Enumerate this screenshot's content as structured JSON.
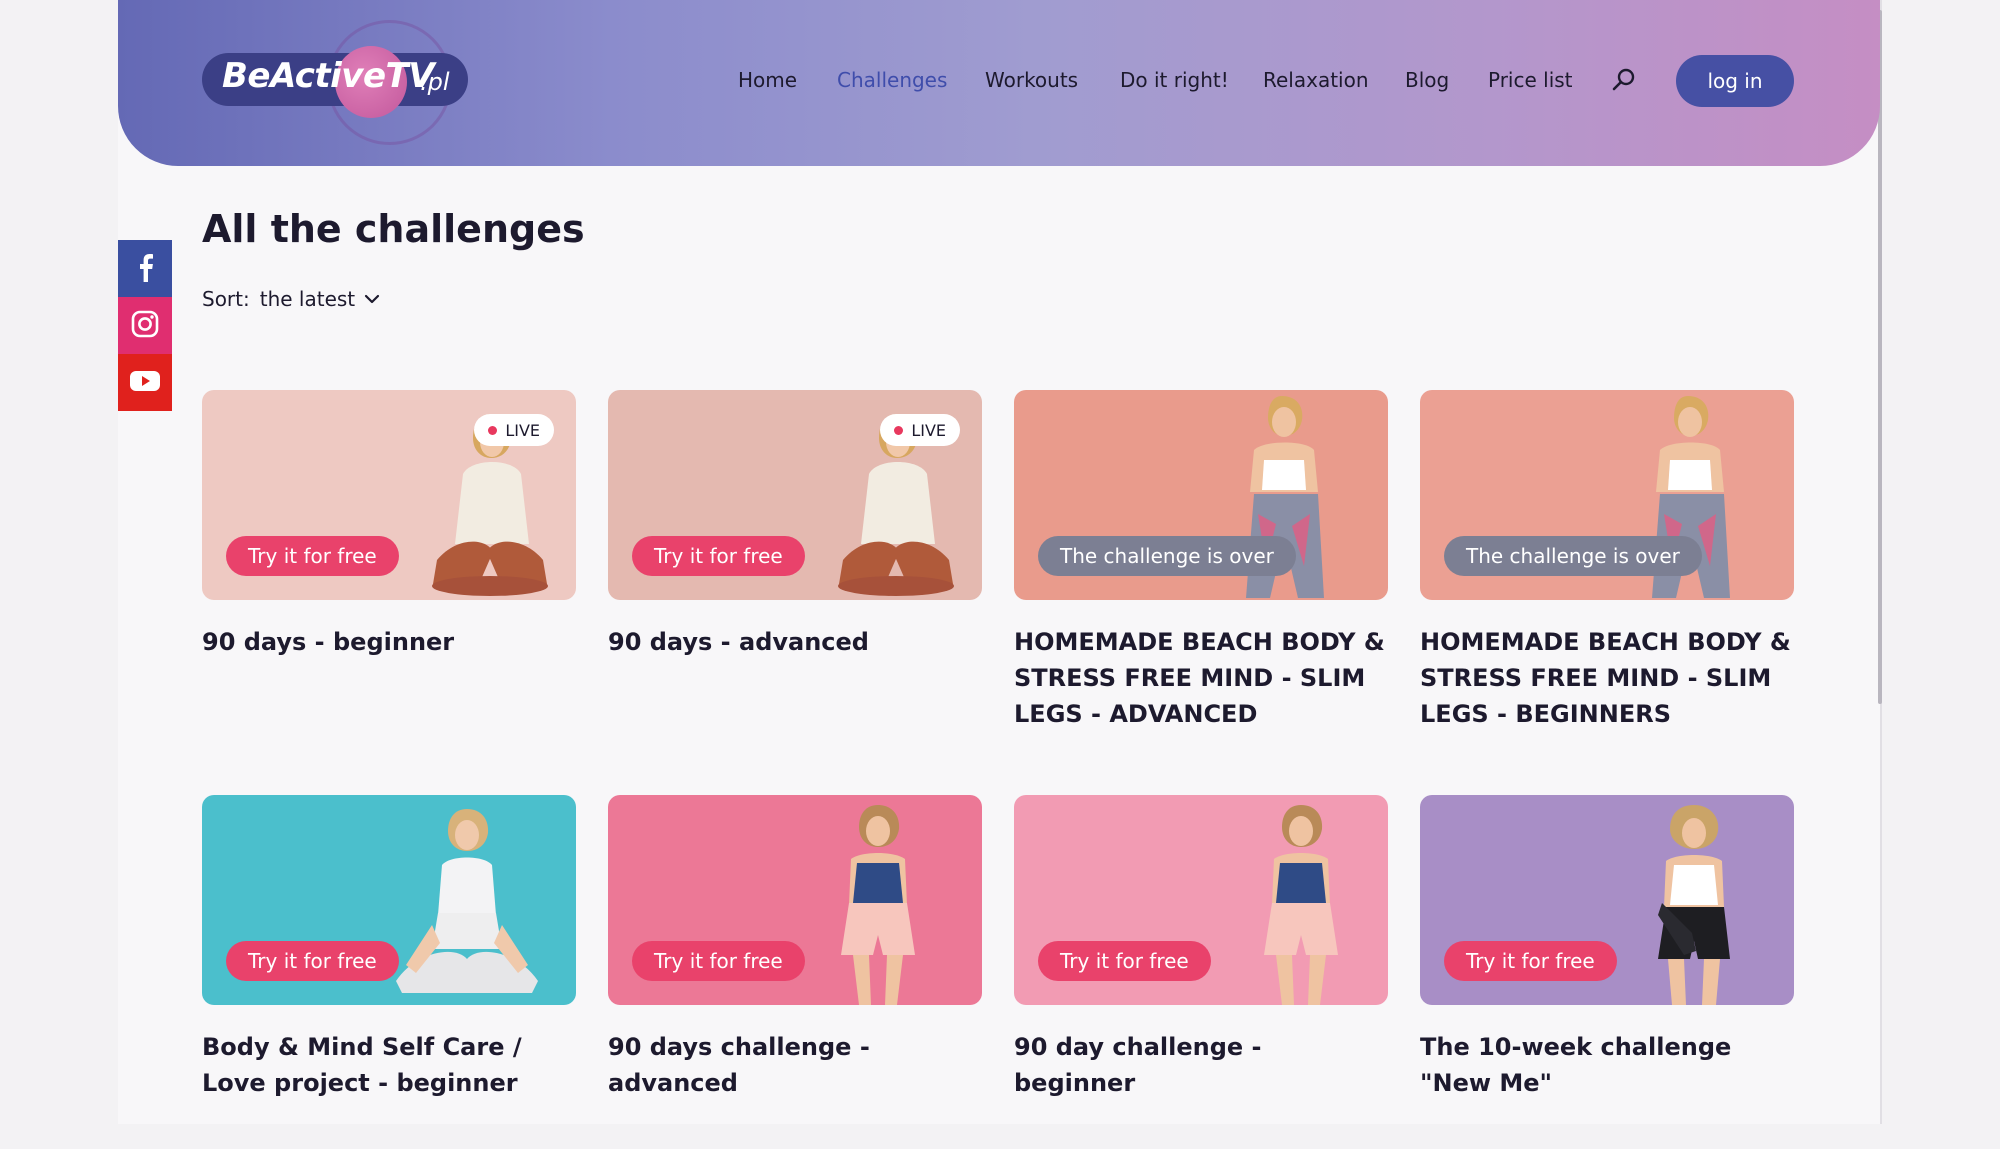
{
  "brand": {
    "logo_text": "BeActiveTV",
    "logo_suffix": ".pl"
  },
  "nav": {
    "items": [
      {
        "label": "Home"
      },
      {
        "label": "Challenges",
        "active": true
      },
      {
        "label": "Workouts"
      },
      {
        "label": "Do it right!"
      },
      {
        "label": "Relaxation"
      },
      {
        "label": "Blog"
      },
      {
        "label": "Price list"
      }
    ],
    "search_icon": "search-icon",
    "login_label": "log in"
  },
  "social": [
    {
      "name": "facebook-icon",
      "color": "#3a4fa0"
    },
    {
      "name": "instagram-icon",
      "color": "#e02e70"
    },
    {
      "name": "youtube-icon",
      "color": "#e0211d"
    }
  ],
  "main": {
    "title": "All the challenges",
    "sort": {
      "label": "Sort:",
      "value": "the latest"
    }
  },
  "cards": [
    {
      "title": "90 days - beginner",
      "badge": "LIVE",
      "cta": "Try it for free",
      "cta_type": "try",
      "bg": "#eec9c2"
    },
    {
      "title": "90 days - advanced",
      "badge": "LIVE",
      "cta": "Try it for free",
      "cta_type": "try",
      "bg": "#e4b9b0"
    },
    {
      "title": "HOMEMADE BEACH BODY & STRESS FREE MIND - SLIM LEGS - ADVANCED",
      "badge": "",
      "cta": "The challenge is over",
      "cta_type": "over",
      "bg": "#e99b8c"
    },
    {
      "title": "HOMEMADE BEACH BODY & STRESS FREE MIND - SLIM LEGS - BEGINNERS",
      "badge": "",
      "cta": "The challenge is over",
      "cta_type": "over",
      "bg": "#eba093"
    },
    {
      "title": "Body & Mind Self Care / Love project - beginner",
      "badge": "",
      "cta": "Try it for free",
      "cta_type": "try",
      "bg": "#4bbfcc"
    },
    {
      "title": "90 days challenge - advanced",
      "badge": "",
      "cta": "Try it for free",
      "cta_type": "try",
      "bg": "#ec7896"
    },
    {
      "title": "90 day challenge - beginner",
      "badge": "",
      "cta": "Try it for free",
      "cta_type": "try",
      "bg": "#f29bb3"
    },
    {
      "title": "The 10-week challenge \"New Me\"",
      "badge": "",
      "cta": "Try it for free",
      "cta_type": "try",
      "bg": "#a88ec6"
    }
  ]
}
